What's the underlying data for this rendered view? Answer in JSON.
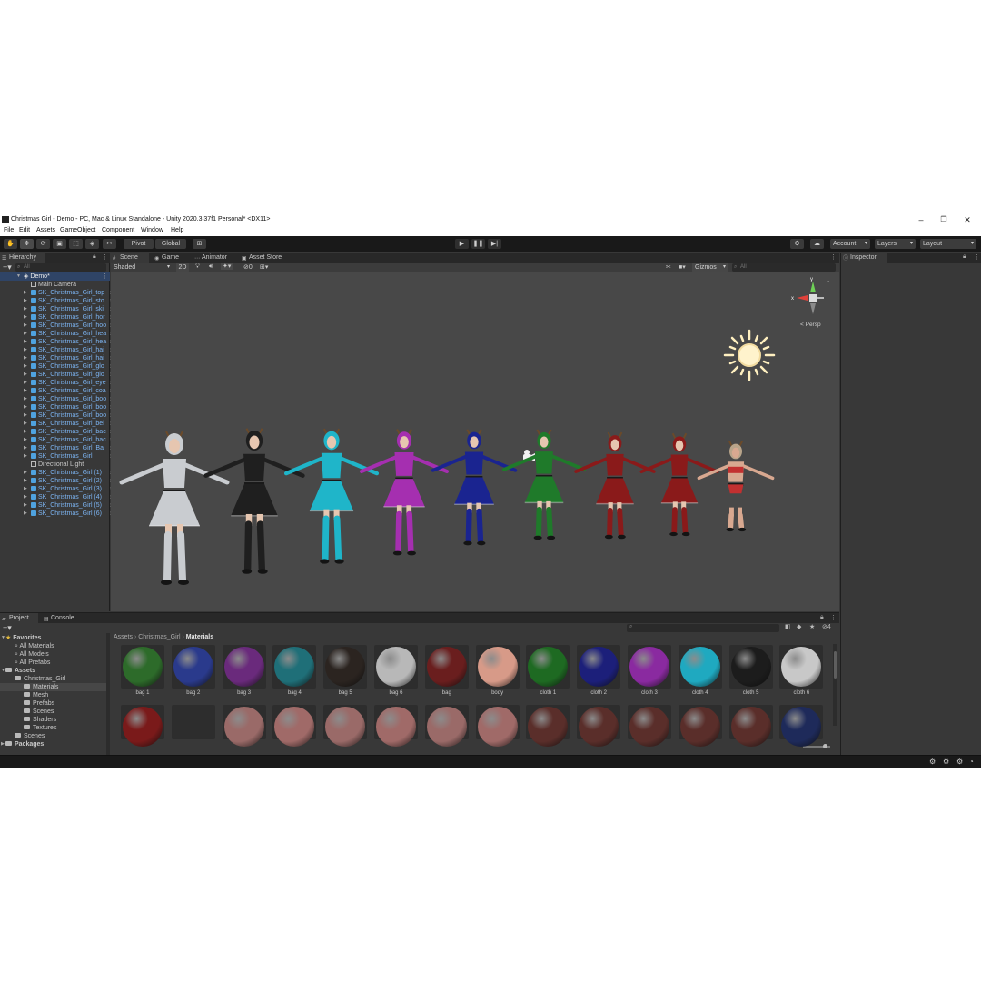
{
  "window": {
    "title": "Christmas Girl - Demo - PC, Mac & Linux Standalone - Unity 2020.3.37f1 Personal* <DX11>",
    "minimize": "–",
    "maximize": "❐",
    "close": "✕"
  },
  "menu": [
    "File",
    "Edit",
    "Assets",
    "GameObject",
    "Component",
    "Window",
    "Help"
  ],
  "toolbar": {
    "pivot": "Pivot",
    "global": "Global",
    "account": "Account",
    "layers": "Layers",
    "layout": "Layout"
  },
  "hierarchy": {
    "tab": "Hierarchy",
    "search_placeholder": "All",
    "scene": "Demo*",
    "items": [
      {
        "label": "Main Camera",
        "kind": "go"
      },
      {
        "label": "SK_Christmas_Girl_top",
        "kind": "prefab"
      },
      {
        "label": "SK_Christmas_Girl_sto",
        "kind": "prefab"
      },
      {
        "label": "SK_Christmas_Girl_ski",
        "kind": "prefab"
      },
      {
        "label": "SK_Christmas_Girl_hor",
        "kind": "prefab"
      },
      {
        "label": "SK_Christmas_Girl_hoo",
        "kind": "prefab"
      },
      {
        "label": "SK_Christmas_Girl_hea",
        "kind": "prefab"
      },
      {
        "label": "SK_Christmas_Girl_hea",
        "kind": "prefab"
      },
      {
        "label": "SK_Christmas_Girl_hai",
        "kind": "prefab"
      },
      {
        "label": "SK_Christmas_Girl_hai",
        "kind": "prefab"
      },
      {
        "label": "SK_Christmas_Girl_glo",
        "kind": "prefab"
      },
      {
        "label": "SK_Christmas_Girl_glo",
        "kind": "prefab"
      },
      {
        "label": "SK_Christmas_Girl_eye",
        "kind": "prefab"
      },
      {
        "label": "SK_Christmas_Girl_coa",
        "kind": "prefab"
      },
      {
        "label": "SK_Christmas_Girl_boo",
        "kind": "prefab"
      },
      {
        "label": "SK_Christmas_Girl_boo",
        "kind": "prefab"
      },
      {
        "label": "SK_Christmas_Girl_boo",
        "kind": "prefab"
      },
      {
        "label": "SK_Christmas_Girl_bel",
        "kind": "prefab"
      },
      {
        "label": "SK_Christmas_Girl_bac",
        "kind": "prefab"
      },
      {
        "label": "SK_Christmas_Girl_bac",
        "kind": "prefab"
      },
      {
        "label": "SK_Christmas_Girl_Ba",
        "kind": "prefab"
      },
      {
        "label": "SK_Christmas_Girl",
        "kind": "prefab"
      },
      {
        "label": "Directional Light",
        "kind": "go"
      },
      {
        "label": "SK_Christmas_Girl (1)",
        "kind": "prefab"
      },
      {
        "label": "SK_Christmas_Girl (2)",
        "kind": "prefab"
      },
      {
        "label": "SK_Christmas_Girl (3)",
        "kind": "prefab"
      },
      {
        "label": "SK_Christmas_Girl (4)",
        "kind": "prefab"
      },
      {
        "label": "SK_Christmas_Girl (5)",
        "kind": "prefab"
      },
      {
        "label": "SK_Christmas_Girl (6)",
        "kind": "prefab"
      }
    ]
  },
  "scene_tabs": [
    "Scene",
    "Game",
    "Animator",
    "Asset Store"
  ],
  "scene_toolbar": {
    "shading": "Shaded",
    "mode_2d": "2D",
    "hidden_count": "0",
    "gizmos": "Gizmos",
    "search_placeholder": "All"
  },
  "gizmo": {
    "x": "x",
    "y": "y",
    "projection": "Persp"
  },
  "characters": [
    {
      "color": "#c9ccd0",
      "skin": "#e6c6b0"
    },
    {
      "color": "#1f1f1f",
      "skin": "#e6c6b0"
    },
    {
      "color": "#1fb5c9",
      "skin": "#e6c6b0"
    },
    {
      "color": "#a52fb0",
      "skin": "#e6c6b0"
    },
    {
      "color": "#1a2490",
      "skin": "#e6c6b0"
    },
    {
      "color": "#1f7a2a",
      "skin": "#e6c6b0"
    },
    {
      "color": "#8a1a1a",
      "skin": "#e6c6b0"
    },
    {
      "color": "#8a1a1a",
      "skin": "#e6c6b0"
    },
    {
      "color": "#c23030",
      "skin": "#d8a890"
    }
  ],
  "inspector": {
    "tab": "Inspector"
  },
  "project": {
    "tabs": [
      "Project",
      "Console"
    ],
    "badge": "4",
    "breadcrumb": [
      "Assets",
      "Christmas_Girl",
      "Materials"
    ],
    "tree": [
      {
        "label": "Favorites",
        "level": 0,
        "icon": "star"
      },
      {
        "label": "All Materials",
        "level": 1,
        "icon": "search"
      },
      {
        "label": "All Models",
        "level": 1,
        "icon": "search"
      },
      {
        "label": "All Prefabs",
        "level": 1,
        "icon": "search"
      },
      {
        "label": "Assets",
        "level": 0,
        "icon": "folder"
      },
      {
        "label": "Christmas_Girl",
        "level": 1,
        "icon": "folder"
      },
      {
        "label": "Materials",
        "level": 2,
        "icon": "folder",
        "selected": true
      },
      {
        "label": "Mesh",
        "level": 2,
        "icon": "folder"
      },
      {
        "label": "Prefabs",
        "level": 2,
        "icon": "folder"
      },
      {
        "label": "Scenes",
        "level": 2,
        "icon": "folder"
      },
      {
        "label": "Shaders",
        "level": 2,
        "icon": "folder"
      },
      {
        "label": "Textures",
        "level": 2,
        "icon": "folder"
      },
      {
        "label": "Scenes",
        "level": 1,
        "icon": "folder"
      },
      {
        "label": "Packages",
        "level": 0,
        "icon": "folder"
      }
    ],
    "materials_row1": [
      {
        "label": "bag 1",
        "color": "#2d6b2a"
      },
      {
        "label": "bag 2",
        "color": "#2a3a8c"
      },
      {
        "label": "bag 3",
        "color": "#6a2a7c"
      },
      {
        "label": "bag 4",
        "color": "#1f6f78"
      },
      {
        "label": "bag 5",
        "color": "#2b2420"
      },
      {
        "label": "bag 6",
        "color": "#b8b8b8"
      },
      {
        "label": "bag",
        "color": "#6a1e1e"
      },
      {
        "label": "body",
        "color": "#d79a88"
      },
      {
        "label": "cloth 1",
        "color": "#1e6a22"
      },
      {
        "label": "cloth 2",
        "color": "#1c1f7a"
      },
      {
        "label": "cloth 3",
        "color": "#8a2aa0"
      },
      {
        "label": "cloth 4",
        "color": "#1fa9c0"
      },
      {
        "label": "cloth 5",
        "color": "#1c1c1c"
      },
      {
        "label": "cloth 6",
        "color": "#c8c8c8"
      }
    ],
    "materials_row2": [
      {
        "color": "#7a1a1a"
      },
      {
        "color": "#3a3a3a"
      },
      {
        "color": "#9a6a68"
      },
      {
        "color": "#a06a68"
      },
      {
        "color": "#9a6a68"
      },
      {
        "color": "#a06a68"
      },
      {
        "color": "#9a6a68"
      },
      {
        "color": "#a06a68"
      },
      {
        "color": "#5a2e2a"
      },
      {
        "color": "#5a2e2a"
      },
      {
        "color": "#5a2e2a"
      },
      {
        "color": "#5a2e2a"
      },
      {
        "color": "#5a2e2a"
      },
      {
        "color": "#1e2a5a"
      }
    ]
  }
}
